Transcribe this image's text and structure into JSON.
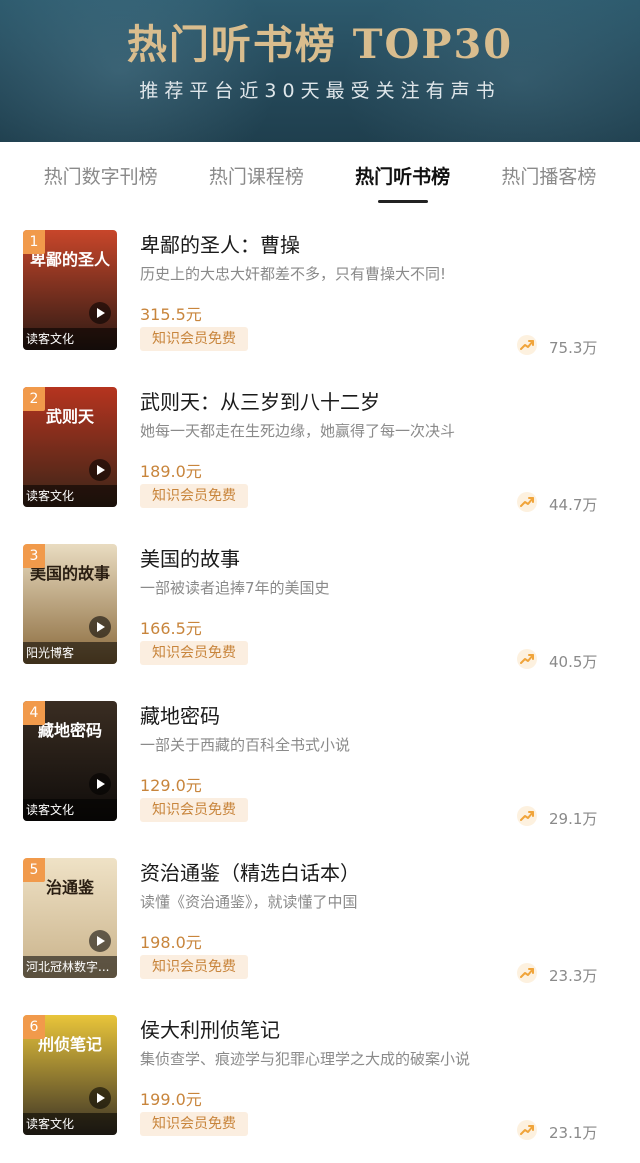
{
  "header": {
    "title": "热门听书榜 TOP30",
    "subtitle": "推荐平台近30天最受关注有声书"
  },
  "tabs": [
    {
      "label": "热门数字刊榜",
      "active": false
    },
    {
      "label": "热门课程榜",
      "active": false
    },
    {
      "label": "热门听书榜",
      "active": true
    },
    {
      "label": "热门播客榜",
      "active": false
    }
  ],
  "colors": {
    "accent": "#c8853c",
    "rank_badge": "#f19a4b",
    "banner": "#25495a",
    "banner_title": "#d9bd8e"
  },
  "items": [
    {
      "rank": "1",
      "title": "卑鄙的圣人：曹操",
      "desc": "历史上的大忠大奸都差不多，只有曹操大不同!",
      "price": "315.5元",
      "badge": "知识会员免费",
      "publisher": "读客文化",
      "count": "75.3万",
      "cover_text": "卑鄙的圣人",
      "cover_colors": [
        "#c8462a",
        "#2b1a14"
      ]
    },
    {
      "rank": "2",
      "title": "武则天：从三岁到八十二岁",
      "desc": "她每一天都走在生死边缘，她赢得了每一次决斗",
      "price": "189.0元",
      "badge": "知识会员免费",
      "publisher": "读客文化",
      "count": "44.7万",
      "cover_text": "武则天",
      "cover_colors": [
        "#b6341f",
        "#3a2518"
      ]
    },
    {
      "rank": "3",
      "title": "美国的故事",
      "desc": "一部被读者追捧7年的美国史",
      "price": "166.5元",
      "badge": "知识会员免费",
      "publisher": "阳光博客",
      "count": "40.5万",
      "cover_text": "美国的故事",
      "cover_colors": [
        "#e9dcc1",
        "#8a6a3c"
      ]
    },
    {
      "rank": "4",
      "title": "藏地密码",
      "desc": "一部关于西藏的百科全书式小说",
      "price": "129.0元",
      "badge": "知识会员免费",
      "publisher": "读客文化",
      "count": "29.1万",
      "cover_text": "藏地密码",
      "cover_colors": [
        "#3a2d22",
        "#0f0c0a"
      ]
    },
    {
      "rank": "5",
      "title": "资治通鉴（精选白话本）",
      "desc": "读懂《资治通鉴》，就读懂了中国",
      "price": "198.0元",
      "badge": "知识会员免费",
      "publisher": "河北冠林数字...",
      "count": "23.3万",
      "cover_text": "治通鉴",
      "cover_colors": [
        "#efe2c6",
        "#c9b28a"
      ]
    },
    {
      "rank": "6",
      "title": "侯大利刑侦笔记",
      "desc": "集侦查学、痕迹学与犯罪心理学之大成的破案小说",
      "price": "199.0元",
      "badge": "知识会员免费",
      "publisher": "读客文化",
      "count": "23.1万",
      "cover_text": "刑侦笔记",
      "cover_colors": [
        "#e9c53a",
        "#3a3226"
      ]
    }
  ]
}
